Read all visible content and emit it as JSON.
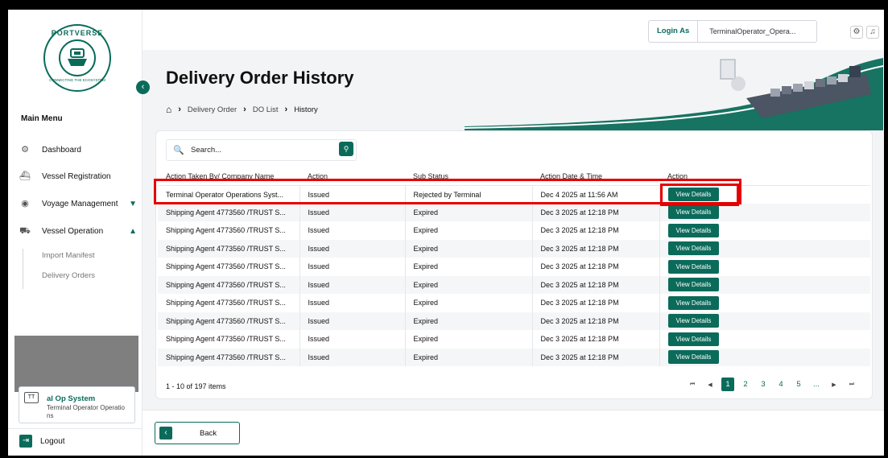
{
  "app": {
    "logo_text": "PORTVERSE",
    "logo_tagline": "CONNECTING THE ECOSYSTEM"
  },
  "sidebar": {
    "menu_title": "Main Menu",
    "items": [
      {
        "label": "Dashboard",
        "icon": "dashboard-icon"
      },
      {
        "label": "Vessel Registration",
        "icon": "ship-icon"
      },
      {
        "label": "Voyage Management",
        "icon": "voyage-icon",
        "expanded": false
      },
      {
        "label": "Vessel Operation",
        "icon": "operation-icon",
        "expanded": true
      }
    ],
    "submenu": [
      "Import Manifest",
      "Delivery Orders"
    ],
    "user": {
      "initials": "TT",
      "name": "al Op System",
      "role": "Terminal Operator Operatio ns"
    },
    "logout_label": "Logout"
  },
  "topbar": {
    "login_as_label": "Login As",
    "login_as_value": "TerminalOperator_Opera..."
  },
  "page": {
    "title": "Delivery Order History",
    "breadcrumb": [
      "Delivery Order",
      "DO List",
      "History"
    ]
  },
  "search": {
    "placeholder": "Search..."
  },
  "table": {
    "headers": [
      "Action Taken By/ Company Name",
      "Action",
      "Sub Status",
      "Action Date & Time",
      "Action"
    ],
    "rows": [
      {
        "company": "Terminal Operator Operations Syst...",
        "action": "Issued",
        "sub_status": "Rejected by Terminal",
        "date": "Dec 4 2025 at 11:56 AM",
        "button": "View Details"
      },
      {
        "company": "Shipping Agent 4773560 /TRUST S...",
        "action": "Issued",
        "sub_status": "Expired",
        "date": "Dec 3 2025 at 12:18 PM",
        "button": "View Details"
      },
      {
        "company": "Shipping Agent 4773560 /TRUST S...",
        "action": "Issued",
        "sub_status": "Expired",
        "date": "Dec 3 2025 at 12:18 PM",
        "button": "View Details"
      },
      {
        "company": "Shipping Agent 4773560 /TRUST S...",
        "action": "Issued",
        "sub_status": "Expired",
        "date": "Dec 3 2025 at 12:18 PM",
        "button": "View Details"
      },
      {
        "company": "Shipping Agent 4773560 /TRUST S...",
        "action": "Issued",
        "sub_status": "Expired",
        "date": "Dec 3 2025 at 12:18 PM",
        "button": "View Details"
      },
      {
        "company": "Shipping Agent 4773560 /TRUST S...",
        "action": "Issued",
        "sub_status": "Expired",
        "date": "Dec 3 2025 at 12:18 PM",
        "button": "View Details"
      },
      {
        "company": "Shipping Agent 4773560 /TRUST S...",
        "action": "Issued",
        "sub_status": "Expired",
        "date": "Dec 3 2025 at 12:18 PM",
        "button": "View Details"
      },
      {
        "company": "Shipping Agent 4773560 /TRUST S...",
        "action": "Issued",
        "sub_status": "Expired",
        "date": "Dec 3 2025 at 12:18 PM",
        "button": "View Details"
      },
      {
        "company": "Shipping Agent 4773560 /TRUST S...",
        "action": "Issued",
        "sub_status": "Expired",
        "date": "Dec 3 2025 at 12:18 PM",
        "button": "View Details"
      },
      {
        "company": "Shipping Agent 4773560 /TRUST S...",
        "action": "Issued",
        "sub_status": "Expired",
        "date": "Dec 3 2025 at 12:18 PM",
        "button": "View Details"
      }
    ]
  },
  "pagination": {
    "info": "1 - 10 of 197 items",
    "pages": [
      "1",
      "2",
      "3",
      "4",
      "5",
      "..."
    ],
    "current": "1"
  },
  "footer": {
    "back_label": "Back"
  },
  "colors": {
    "brand": "#0b6b5a",
    "highlight": "#e60000"
  }
}
